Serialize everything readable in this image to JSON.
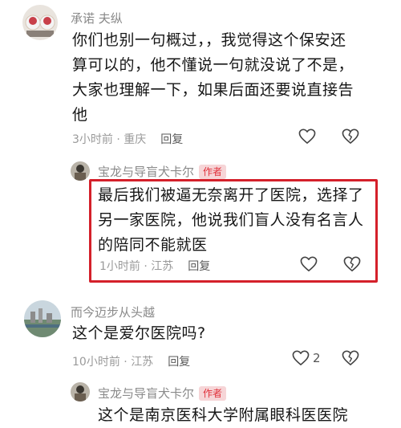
{
  "comments": [
    {
      "username": "承诺  夫纵",
      "text_lines": [
        "你们也别一句概过，，我觉得这个保安还",
        "算可以的，他不懂说一句就没说了不是，",
        "大家也理解一下，如果后面还要说直接告",
        "他"
      ],
      "time": "3小时前",
      "location": "重庆",
      "reply_label": "回复",
      "like_count": ""
    },
    {
      "username": "宝龙与导盲犬卡尔",
      "badge": "作者",
      "text_lines": [
        "最后我们被逼无奈离开了医院，选择了",
        "另一家医院，他说我们盲人没有名言人",
        "的陪同不能就医"
      ],
      "time": "1小时前",
      "location": "江苏",
      "reply_label": "回复",
      "like_count": ""
    },
    {
      "username": "而今迈步从头越",
      "text_lines": [
        "这个是爱尔医院吗?"
      ],
      "time": "10小时前",
      "location": "江苏",
      "reply_label": "回复",
      "like_count": "2"
    },
    {
      "username": "宝龙与导盲犬卡尔",
      "badge": "作者",
      "text_lines": [
        "这个是南京医科大学附属眼科医医院"
      ]
    }
  ],
  "meta_separator": " · ",
  "colors": {
    "author_badge_bg": "#f6d5d7",
    "author_badge_text": "#e0303a",
    "highlight_border": "#d4202a"
  },
  "icons": [
    "heart-icon",
    "broken-heart-icon"
  ]
}
